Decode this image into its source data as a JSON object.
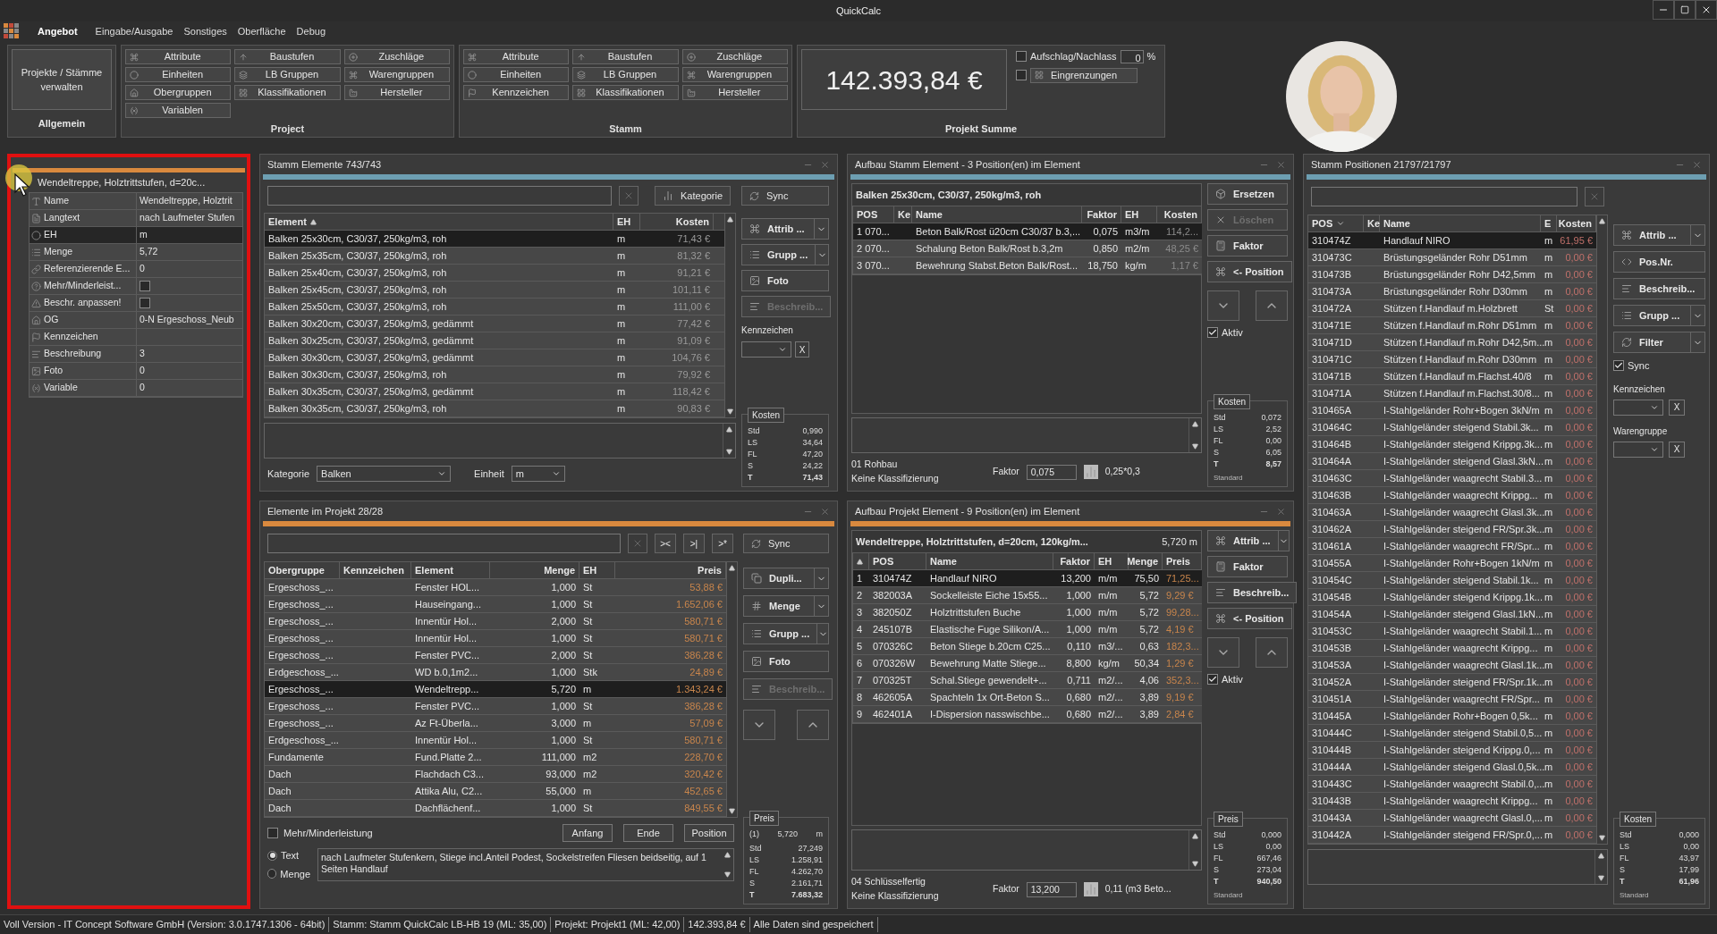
{
  "window": {
    "title": "QuickCalc"
  },
  "menu": [
    {
      "label": "Angebot",
      "selected": true
    },
    {
      "label": "Eingabe/Ausgabe",
      "selected": false
    },
    {
      "label": "Sonstiges",
      "selected": false
    },
    {
      "label": "Oberfläche",
      "selected": false
    },
    {
      "label": "Debug",
      "selected": false
    }
  ],
  "ribbon": {
    "general": {
      "title": "Allgemein",
      "button": "Projekte / Stämme verwalten"
    },
    "groups": [
      {
        "title": "Project",
        "columns": [
          [
            "Attribute",
            "Einheiten",
            "Obergruppen",
            "Variablen"
          ],
          [
            "Baustufen",
            "LB Gruppen",
            "Klassifikationen"
          ],
          [
            "Zuschläge",
            "Warengruppen",
            "Hersteller"
          ]
        ]
      },
      {
        "title": "Stamm",
        "columns": [
          [
            "Attribute",
            "Einheiten",
            "Kennzeichen"
          ],
          [
            "Baustufen",
            "LB Gruppen",
            "Klassifikationen"
          ],
          [
            "Zuschläge",
            "Warengruppen",
            "Hersteller"
          ]
        ]
      }
    ],
    "sum": {
      "title": "Projekt Summe",
      "total": "142.393,84 €",
      "surcharge": {
        "label": "Aufschlag/Nachlass",
        "checked": false,
        "value": "0",
        "unit": "%"
      },
      "limits": {
        "label": "Eingrenzungen",
        "checked": false
      }
    }
  },
  "properties": {
    "selected_item": "Wendeltreppe, Holztrittstufen, d=20c...",
    "rows": [
      {
        "label": "Name",
        "kind": "text",
        "value": "Wendeltreppe, Holztrit",
        "selected": false
      },
      {
        "label": "Langtext",
        "kind": "text",
        "value": "nach Laufmeter Stufen",
        "selected": false
      },
      {
        "label": "EH",
        "kind": "text",
        "value": "m",
        "selected": true
      },
      {
        "label": "Menge",
        "kind": "text",
        "value": "5,72",
        "selected": false
      },
      {
        "label": "Referenzierende E...",
        "kind": "text",
        "value": "0",
        "selected": false
      },
      {
        "label": "Mehr/Minderleist...",
        "kind": "checkbox",
        "checked": false,
        "selected": false
      },
      {
        "label": "Beschr. anpassen!",
        "kind": "checkbox",
        "checked": false,
        "selected": false
      },
      {
        "label": "OG",
        "kind": "text",
        "value": "0-N Ergeschoss_Neub",
        "selected": false
      },
      {
        "label": "Kennzeichen",
        "kind": "text",
        "selected": false
      },
      {
        "label": "Beschreibung",
        "kind": "text",
        "value": "3",
        "selected": false
      },
      {
        "label": "Foto",
        "kind": "text",
        "value": "0",
        "selected": false
      },
      {
        "label": "Variable",
        "kind": "text",
        "value": "0",
        "selected": false
      }
    ]
  },
  "stamm_elemente": {
    "title": "Stamm Elemente 743/743",
    "category_button": "Kategorie",
    "sync_button": "Sync",
    "columns": [
      "Element",
      "EH",
      "Kosten"
    ],
    "rows": [
      {
        "cells": [
          "Balken 25x30cm, C30/37, 250kg/m3,  roh",
          "m",
          "71,43 €"
        ],
        "selected": true
      },
      {
        "cells": [
          "Balken 25x35cm, C30/37, 250kg/m3,  roh",
          "m",
          "81,32 €"
        ],
        "selected": false
      },
      {
        "cells": [
          "Balken 25x40cm, C30/37, 250kg/m3,  roh",
          "m",
          "91,21 €"
        ],
        "selected": false
      },
      {
        "cells": [
          "Balken 25x45cm, C30/37, 250kg/m3,  roh",
          "m",
          "101,11 €"
        ],
        "selected": false
      },
      {
        "cells": [
          "Balken 25x50cm, C30/37, 250kg/m3,  roh",
          "m",
          "111,00 €"
        ],
        "selected": false
      },
      {
        "cells": [
          "Balken 30x20cm, C30/37, 250kg/m3,  gedämmt",
          "m",
          "77,42 €"
        ],
        "selected": false
      },
      {
        "cells": [
          "Balken 30x25cm, C30/37, 250kg/m3,  gedämmt",
          "m",
          "91,09 €"
        ],
        "selected": false
      },
      {
        "cells": [
          "Balken 30x30cm, C30/37, 250kg/m3,  gedämmt",
          "m",
          "104,76 €"
        ],
        "selected": false
      },
      {
        "cells": [
          "Balken 30x30cm, C30/37, 250kg/m3,  roh",
          "m",
          "79,92 €"
        ],
        "selected": false
      },
      {
        "cells": [
          "Balken 30x35cm, C30/37, 250kg/m3,  gedämmt",
          "m",
          "118,42 €"
        ],
        "selected": false
      },
      {
        "cells": [
          "Balken 30x35cm, C30/37, 250kg/m3,  roh",
          "m",
          "90,83 €"
        ],
        "selected": false
      }
    ],
    "side_buttons": [
      {
        "label": "Attrib ...",
        "dropdown": true,
        "disabled": false
      },
      {
        "label": "Grupp ...",
        "dropdown": true,
        "disabled": false
      },
      {
        "label": "Foto",
        "dropdown": false,
        "disabled": false
      },
      {
        "label": "Beschreib...",
        "dropdown": false,
        "disabled": true
      }
    ],
    "marker_label": "Kennzeichen",
    "clear_button": "X",
    "costs": {
      "title": "Kosten",
      "rows": [
        {
          "label": "Std",
          "value": "0,990"
        },
        {
          "label": "LS",
          "value": "34,64"
        },
        {
          "label": "FL",
          "value": "47,20"
        },
        {
          "label": "S",
          "value": "24,22"
        },
        {
          "label": "T",
          "value": "71,43"
        }
      ]
    },
    "category": {
      "label": "Kategorie",
      "value": "Balken"
    },
    "unit": {
      "label": "Einheit",
      "value": "m"
    }
  },
  "aufbau_stamm": {
    "title": "Aufbau Stamm Element - 3 Position(en) im Element",
    "element": "Balken 25x30cm, C30/37, 250kg/m3,  roh",
    "columns": [
      "POS",
      "Ke",
      "Name",
      "Faktor",
      "EH",
      "Kosten"
    ],
    "rows": [
      {
        "cells": [
          "1 070...",
          "",
          "Beton Balk/Rost ü20cm C30/37 b.3,...",
          "0,075",
          "m3/m",
          "114,2..."
        ],
        "selected": true
      },
      {
        "cells": [
          "2 070...",
          "",
          "Schalung Beton Balk/Rost b.3,2m",
          "0,850",
          "m2/m",
          "48,25 €"
        ],
        "selected": false
      },
      {
        "cells": [
          "3 070...",
          "",
          "Bewehrung Stabst.Beton Balk/Rost...",
          "18,750",
          "kg/m",
          "1,17 €"
        ],
        "selected": false
      }
    ],
    "side_buttons": [
      {
        "label": "Ersetzen",
        "dropdown": false,
        "disabled": false
      },
      {
        "label": "Löschen",
        "dropdown": false,
        "disabled": true
      },
      {
        "label": "Faktor",
        "dropdown": false,
        "disabled": false
      },
      {
        "label": "<- Position",
        "dropdown": false,
        "disabled": false
      }
    ],
    "active": {
      "label": "Aktiv",
      "checked": true
    },
    "costs": {
      "title": "Kosten",
      "rows": [
        {
          "label": "Std",
          "value": "0,072"
        },
        {
          "label": "LS",
          "value": "2,52"
        },
        {
          "label": "FL",
          "value": "0,00"
        },
        {
          "label": "S",
          "value": "6,05"
        },
        {
          "label": "T",
          "value": "8,57"
        }
      ],
      "footer": "Standard"
    },
    "stage": "01 Rohbau",
    "classification": "Keine Klassifizierung",
    "factor": {
      "label": "Faktor",
      "value": "0,075",
      "formula": "0,25*0,3"
    }
  },
  "elemente_projekt": {
    "title": "Elemente im Projekt 28/28",
    "nav_buttons": [
      "><",
      ">|",
      ">*"
    ],
    "sync_button": "Sync",
    "columns": [
      "Obergruppe",
      "Kennzeichen",
      "Element",
      "Menge",
      "EH",
      "Preis"
    ],
    "rows": [
      {
        "cells": [
          "Ergeschoss_...",
          "",
          "Fenster HOL...",
          "1,000",
          "St",
          "53,88 €"
        ],
        "selected": false
      },
      {
        "cells": [
          "Ergeschoss_...",
          "",
          "Hauseingang...",
          "1,000",
          "St",
          "1.652,06 €"
        ],
        "selected": false
      },
      {
        "cells": [
          "Ergeschoss_...",
          "",
          "Innentür Hol...",
          "2,000",
          "St",
          "580,71 €"
        ],
        "selected": false
      },
      {
        "cells": [
          "Ergeschoss_...",
          "",
          "Innentür Hol...",
          "1,000",
          "St",
          "580,71 €"
        ],
        "selected": false
      },
      {
        "cells": [
          "Ergeschoss_...",
          "",
          "Fenster PVC...",
          "2,000",
          "St",
          "386,28 €"
        ],
        "selected": false
      },
      {
        "cells": [
          "Erdgeschoss_...",
          "",
          "WD b.0,1m2...",
          "1,000",
          "Stk",
          "24,89 €"
        ],
        "selected": false
      },
      {
        "cells": [
          "Ergeschoss_...",
          "",
          "Wendeltrepp...",
          "5,720",
          "m",
          "1.343,24 €"
        ],
        "selected": true
      },
      {
        "cells": [
          "Ergeschoss_...",
          "",
          "Fenster PVC...",
          "1,000",
          "St",
          "386,28 €"
        ],
        "selected": false
      },
      {
        "cells": [
          "Ergeschoss_...",
          "",
          "Az Ft-Überla...",
          "3,000",
          "m",
          "57,09 €"
        ],
        "selected": false
      },
      {
        "cells": [
          "Erdgeschoss_...",
          "",
          "Innentür Hol...",
          "1,000",
          "St",
          "580,71 €"
        ],
        "selected": false
      },
      {
        "cells": [
          "Fundamente",
          "",
          "Fund.Platte 2...",
          "111,000",
          "m2",
          "228,70 €"
        ],
        "selected": false
      },
      {
        "cells": [
          "Dach",
          "",
          "Flachdach C3...",
          "93,000",
          "m2",
          "320,42 €"
        ],
        "selected": false
      },
      {
        "cells": [
          "Dach",
          "",
          "Attika Alu, C2...",
          "55,000",
          "m",
          "452,65 €"
        ],
        "selected": false
      },
      {
        "cells": [
          "Dach",
          "",
          "Dachflächenf...",
          "1,000",
          "St",
          "849,55 €"
        ],
        "selected": false
      }
    ],
    "side_buttons": [
      {
        "label": "Dupli...",
        "dropdown": true,
        "disabled": false
      },
      {
        "label": "Menge",
        "dropdown": true,
        "disabled": false
      },
      {
        "label": "Grupp ...",
        "dropdown": true,
        "disabled": false
      },
      {
        "label": "Foto",
        "dropdown": false,
        "disabled": false
      },
      {
        "label": "Beschreib...",
        "dropdown": false,
        "disabled": true
      }
    ],
    "price": {
      "title": "Preis",
      "quantity": {
        "label": "(1)",
        "value": "5,720",
        "unit": "m"
      },
      "rows": [
        {
          "label": "Std",
          "value": "27,249"
        },
        {
          "label": "LS",
          "value": "1.258,91"
        },
        {
          "label": "FL",
          "value": "4.262,70"
        },
        {
          "label": "S",
          "value": "2.161,71"
        },
        {
          "label": "T",
          "value": "7.683,32"
        }
      ]
    },
    "extra": {
      "label": "Mehr/Minderleistung",
      "checked": false
    },
    "text_buttons": [
      "Anfang",
      "Ende",
      "Position"
    ],
    "modes": [
      {
        "label": "Text",
        "selected": true
      },
      {
        "label": "Menge",
        "selected": false
      }
    ],
    "description": "nach Laufmeter Stufenkern, Stiege incl.Anteil Podest, Sockelstreifen Fliesen beidseitig, auf 1 Seiten Handlauf"
  },
  "aufbau_projekt": {
    "title": "Aufbau Projekt Element - 9 Position(en) im Element",
    "element": "Wendeltreppe,  Holztrittstufen,  d=20cm,  120kg/m...",
    "quantity": "5,720 m",
    "columns": [
      "",
      "POS",
      "Name",
      "Faktor",
      "EH",
      "Menge",
      "Preis"
    ],
    "rows": [
      {
        "cells": [
          "1",
          "310474Z",
          "Handlauf NIRO",
          "13,200",
          "m/m",
          "75,50",
          "71,25..."
        ],
        "selected": true
      },
      {
        "cells": [
          "2",
          "382003A",
          "Sockelleiste Eiche 15x55...",
          "1,000",
          "m/m",
          "5,72",
          "9,29 €"
        ],
        "selected": false
      },
      {
        "cells": [
          "3",
          "382050Z",
          "Holztrittstufen Buche",
          "1,000",
          "m/m",
          "5,72",
          "99,28..."
        ],
        "selected": false
      },
      {
        "cells": [
          "4",
          "245107B",
          "Elastische Fuge Silikon/A...",
          "1,000",
          "m/m",
          "5,72",
          "4,19 €"
        ],
        "selected": false
      },
      {
        "cells": [
          "5",
          "070326C",
          "Beton Stiege b.20cm C25...",
          "0,110",
          "m3/...",
          "0,63",
          "182,3..."
        ],
        "selected": false
      },
      {
        "cells": [
          "6",
          "070326W",
          "Bewehrung Matte Stiege...",
          "8,800",
          "kg/m",
          "50,34",
          "1,29 €"
        ],
        "selected": false
      },
      {
        "cells": [
          "7",
          "070325T",
          "Schal.Stiege gewendelt+...",
          "0,711",
          "m2/...",
          "4,06",
          "352,3..."
        ],
        "selected": false
      },
      {
        "cells": [
          "8",
          "462605A",
          "Spachteln 1x Ort-Beton S...",
          "0,680",
          "m2/...",
          "3,89",
          "9,19 €"
        ],
        "selected": false
      },
      {
        "cells": [
          "9",
          "462401A",
          "I-Dispersion nasswischbe...",
          "0,680",
          "m2/...",
          "3,89",
          "2,84 €"
        ],
        "selected": false
      }
    ],
    "side_buttons": [
      {
        "label": "Attrib ...",
        "dropdown": true,
        "disabled": false
      },
      {
        "label": "Faktor",
        "dropdown": false,
        "disabled": false
      },
      {
        "label": "Beschreib...",
        "dropdown": false,
        "disabled": false
      },
      {
        "label": "<- Position",
        "dropdown": false,
        "disabled": false
      }
    ],
    "active": {
      "label": "Aktiv",
      "checked": true
    },
    "price": {
      "title": "Preis",
      "rows": [
        {
          "label": "Std",
          "value": "0,000"
        },
        {
          "label": "LS",
          "value": "0,00"
        },
        {
          "label": "FL",
          "value": "667,46"
        },
        {
          "label": "S",
          "value": "273,04"
        },
        {
          "label": "T",
          "value": "940,50"
        }
      ],
      "footer": "Standard"
    },
    "stage": "04 Schlüsselfertig",
    "classification": "Keine Klassifizierung",
    "factor": {
      "label": "Faktor",
      "value": "13,200",
      "formula": "0,11 (m3 Beto..."
    }
  },
  "stamm_positionen": {
    "title": "Stamm Positionen 21797/21797",
    "columns": [
      "POS",
      "Ke",
      "Name",
      "E",
      "Kosten"
    ],
    "rows": [
      {
        "cells": [
          "310474Z",
          "",
          "Handlauf NIRO",
          "m",
          "61,95 €"
        ],
        "selected": true
      },
      {
        "cells": [
          "310473C",
          "",
          "Brüstungsgeländer Rohr D51mm",
          "m",
          "0,00 €"
        ],
        "selected": false
      },
      {
        "cells": [
          "310473B",
          "",
          "Brüstungsgeländer Rohr D42,5mm",
          "m",
          "0,00 €"
        ],
        "selected": false
      },
      {
        "cells": [
          "310473A",
          "",
          "Brüstungsgeländer Rohr D30mm",
          "m",
          "0,00 €"
        ],
        "selected": false
      },
      {
        "cells": [
          "310472A",
          "",
          "Stützen f.Handlauf m.Holzbrett",
          "St",
          "0,00 €"
        ],
        "selected": false
      },
      {
        "cells": [
          "310471E",
          "",
          "Stützen f.Handlauf m.Rohr D51mm",
          "m",
          "0,00 €"
        ],
        "selected": false
      },
      {
        "cells": [
          "310471D",
          "",
          "Stützen f.Handlauf m.Rohr D42,5m...",
          "m",
          "0,00 €"
        ],
        "selected": false
      },
      {
        "cells": [
          "310471C",
          "",
          "Stützen f.Handlauf m.Rohr D30mm",
          "m",
          "0,00 €"
        ],
        "selected": false
      },
      {
        "cells": [
          "310471B",
          "",
          "Stützen f.Handlauf m.Flachst.40/8",
          "m",
          "0,00 €"
        ],
        "selected": false
      },
      {
        "cells": [
          "310471A",
          "",
          "Stützen f.Handlauf m.Flachst.30/8...",
          "m",
          "0,00 €"
        ],
        "selected": false
      },
      {
        "cells": [
          "310465A",
          "",
          "I-Stahlgeländer Rohr+Bogen 3kN/m",
          "m",
          "0,00 €"
        ],
        "selected": false
      },
      {
        "cells": [
          "310464C",
          "",
          "I-Stahlgeländer steigend Stabil.3k...",
          "m",
          "0,00 €"
        ],
        "selected": false
      },
      {
        "cells": [
          "310464B",
          "",
          "I-Stahlgeländer steigend Krippg.3k...",
          "m",
          "0,00 €"
        ],
        "selected": false
      },
      {
        "cells": [
          "310464A",
          "",
          "I-Stahlgeländer steigend Glasl.3kN...",
          "m",
          "0,00 €"
        ],
        "selected": false
      },
      {
        "cells": [
          "310463C",
          "",
          "I-Stahlgeländer waagrecht Stabil.3...",
          "m",
          "0,00 €"
        ],
        "selected": false
      },
      {
        "cells": [
          "310463B",
          "",
          "I-Stahlgeländer waagrecht Krippg...",
          "m",
          "0,00 €"
        ],
        "selected": false
      },
      {
        "cells": [
          "310463A",
          "",
          "I-Stahlgeländer waagrecht Glasl.3k...",
          "m",
          "0,00 €"
        ],
        "selected": false
      },
      {
        "cells": [
          "310462A",
          "",
          "I-Stahlgeländer steigend FR/Spr.3k...",
          "m",
          "0,00 €"
        ],
        "selected": false
      },
      {
        "cells": [
          "310461A",
          "",
          "I-Stahlgeländer waagrecht FR/Spr...",
          "m",
          "0,00 €"
        ],
        "selected": false
      },
      {
        "cells": [
          "310455A",
          "",
          "I-Stahlgeländer Rohr+Bogen 1kN/m",
          "m",
          "0,00 €"
        ],
        "selected": false
      },
      {
        "cells": [
          "310454C",
          "",
          "I-Stahlgeländer steigend Stabil.1k...",
          "m",
          "0,00 €"
        ],
        "selected": false
      },
      {
        "cells": [
          "310454B",
          "",
          "I-Stahlgeländer steigend Krippg.1k...",
          "m",
          "0,00 €"
        ],
        "selected": false
      },
      {
        "cells": [
          "310454A",
          "",
          "I-Stahlgeländer steigend Glasl.1kN...",
          "m",
          "0,00 €"
        ],
        "selected": false
      },
      {
        "cells": [
          "310453C",
          "",
          "I-Stahlgeländer waagrecht Stabil.1...",
          "m",
          "0,00 €"
        ],
        "selected": false
      },
      {
        "cells": [
          "310453B",
          "",
          "I-Stahlgeländer waagrecht Krippg...",
          "m",
          "0,00 €"
        ],
        "selected": false
      },
      {
        "cells": [
          "310453A",
          "",
          "I-Stahlgeländer waagrecht Glasl.1k...",
          "m",
          "0,00 €"
        ],
        "selected": false
      },
      {
        "cells": [
          "310452A",
          "",
          "I-Stahlgeländer steigend FR/Spr.1k...",
          "m",
          "0,00 €"
        ],
        "selected": false
      },
      {
        "cells": [
          "310451A",
          "",
          "I-Stahlgeländer waagrecht FR/Spr...",
          "m",
          "0,00 €"
        ],
        "selected": false
      },
      {
        "cells": [
          "310445A",
          "",
          "I-Stahlgeländer Rohr+Bogen 0,5k...",
          "m",
          "0,00 €"
        ],
        "selected": false
      },
      {
        "cells": [
          "310444C",
          "",
          "I-Stahlgeländer steigend Stabil.0,5...",
          "m",
          "0,00 €"
        ],
        "selected": false
      },
      {
        "cells": [
          "310444B",
          "",
          "I-Stahlgeländer steigend Krippg.0,...",
          "m",
          "0,00 €"
        ],
        "selected": false
      },
      {
        "cells": [
          "310444A",
          "",
          "I-Stahlgeländer steigend Glasl.0,5k...",
          "m",
          "0,00 €"
        ],
        "selected": false
      },
      {
        "cells": [
          "310443C",
          "",
          "I-Stahlgeländer waagrecht Stabil.0,...",
          "m",
          "0,00 €"
        ],
        "selected": false
      },
      {
        "cells": [
          "310443B",
          "",
          "I-Stahlgeländer waagrecht Krippg...",
          "m",
          "0,00 €"
        ],
        "selected": false
      },
      {
        "cells": [
          "310443A",
          "",
          "I-Stahlgeländer waagrecht Glasl.0,...",
          "m",
          "0,00 €"
        ],
        "selected": false
      },
      {
        "cells": [
          "310442A",
          "",
          "I-Stahlgeländer steigend FR/Spr.0,...",
          "m",
          "0,00 €"
        ],
        "selected": false
      }
    ],
    "side_buttons": [
      {
        "label": "Attrib ...",
        "dropdown": true,
        "disabled": false
      },
      {
        "label": "Pos.Nr.",
        "dropdown": false,
        "disabled": false
      },
      {
        "label": "Beschreib...",
        "dropdown": false,
        "disabled": false
      },
      {
        "label": "Grupp ...",
        "dropdown": true,
        "disabled": false
      },
      {
        "label": "Filter",
        "dropdown": true,
        "disabled": false
      }
    ],
    "sync": {
      "label": "Sync",
      "checked": true
    },
    "filters": [
      {
        "label": "Kennzeichen",
        "clear": "X"
      },
      {
        "label": "Warengruppe",
        "clear": "X"
      }
    ],
    "costs": {
      "title": "Kosten",
      "rows": [
        {
          "label": "Std",
          "value": "0,000"
        },
        {
          "label": "LS",
          "value": "0,00"
        },
        {
          "label": "FL",
          "value": "43,97"
        },
        {
          "label": "S",
          "value": "17,99"
        },
        {
          "label": "T",
          "value": "61,96"
        }
      ],
      "footer": "Standard"
    }
  },
  "status_bar": [
    "Voll Version - IT Concept Software GmbH (Version: 3.0.1747.1306 - 64bit)",
    "Stamm: Stamm QuickCalc LB-HB 19 (ML: 35,00)",
    "Projekt: Projekt1 (ML: 42,00)",
    "142.393,84 €",
    "Alle Daten sind gespeichert"
  ]
}
